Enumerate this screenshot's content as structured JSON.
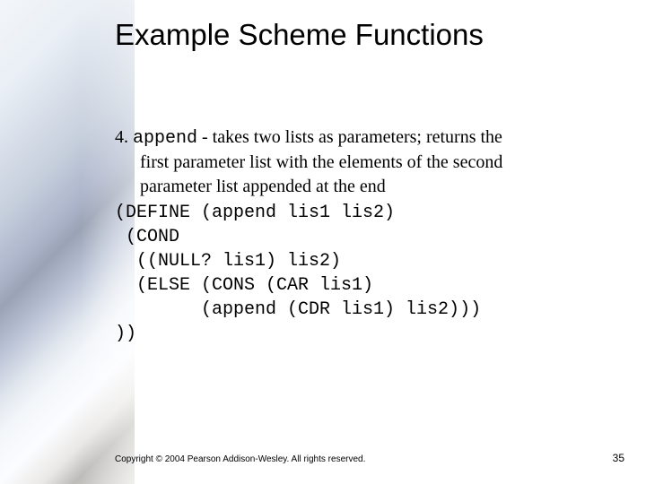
{
  "title": "Example Scheme Functions",
  "body": {
    "item_number": "4.",
    "func_name": "append",
    "desc_part1": " - takes two lists as parameters; returns the",
    "desc_line2": "first parameter list with the elements of the second",
    "desc_line3": "parameter list appended at the end",
    "code_line1": "(DEFINE (append lis1 lis2)",
    "code_line2": " (COND",
    "code_line3": "  ((NULL? lis1) lis2)",
    "code_line4": "  (ELSE (CONS (CAR lis1)",
    "code_line5": "        (append (CDR lis1) lis2)))",
    "code_line6": "))"
  },
  "footer": {
    "copyright": "Copyright © 2004 Pearson Addison-Wesley. All rights reserved.",
    "page_number": "35"
  }
}
